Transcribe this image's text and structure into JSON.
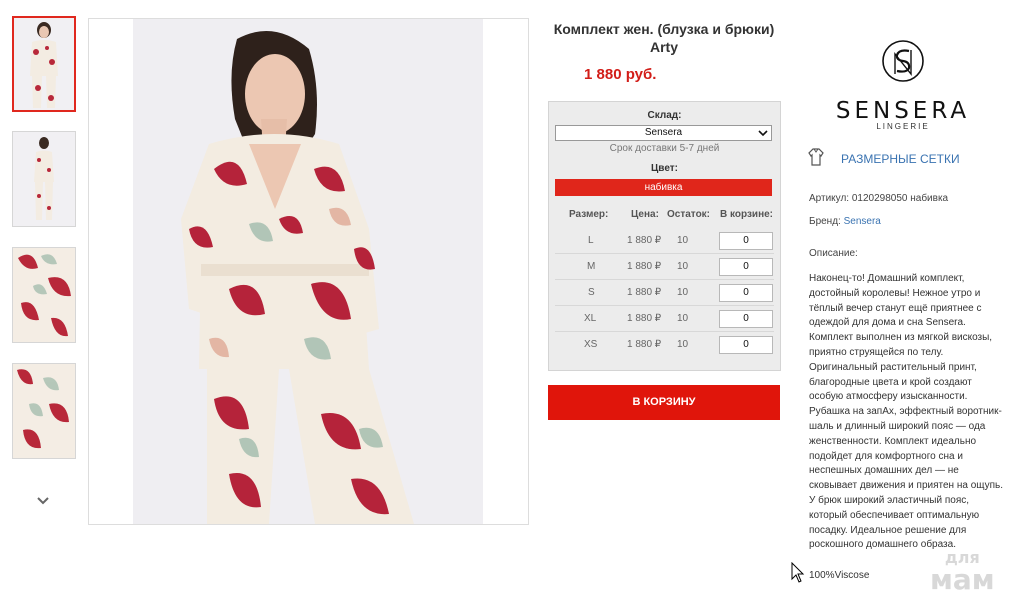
{
  "product": {
    "title": "Комплект жен. (блузка и брюки) Arty",
    "price": "1 880 руб."
  },
  "thumbnails": [
    {
      "label": "thumb-1",
      "active": true
    },
    {
      "label": "thumb-2",
      "active": false
    },
    {
      "label": "thumb-3",
      "active": false
    },
    {
      "label": "thumb-4",
      "active": false
    }
  ],
  "panel": {
    "warehouse_label": "Склад:",
    "warehouse_value": "Sensera",
    "delivery": "Срок доставки 5-7 дней",
    "color_label": "Цвет:",
    "color_value": "набивка",
    "headers": [
      "Размер:",
      "Цена:",
      "Остаток:",
      "В корзине:"
    ],
    "rows": [
      {
        "size": "L",
        "price": "1 880 ₽",
        "stock": "10",
        "qty": "0"
      },
      {
        "size": "M",
        "price": "1 880 ₽",
        "stock": "10",
        "qty": "0"
      },
      {
        "size": "S",
        "price": "1 880 ₽",
        "stock": "10",
        "qty": "0"
      },
      {
        "size": "XL",
        "price": "1 880 ₽",
        "stock": "10",
        "qty": "0"
      },
      {
        "size": "XS",
        "price": "1 880 ₽",
        "stock": "10",
        "qty": "0"
      }
    ]
  },
  "cart_button": "В КОРЗИНУ",
  "brand": {
    "name": "SENSERA",
    "sub": "LINGERIE",
    "size_charts": "РАЗМЕРНЫЕ СЕТКИ",
    "article_label": "Артикул:",
    "article_value": "0120298050 набивка",
    "brand_label": "Бренд:",
    "brand_value": "Sensera",
    "desc_label": "Описание:",
    "description": "Наконец-то! Домашний комплект, достойный королевы! Нежное утро и тёплый вечер станут ещё приятнее с одеждой для дома и сна Sensera. Комплект выполнен из мягкой вискозы, приятно струящейся по телу. Оригинальный растительный принт, благородные цвета и крой создают особую атмосферу изысканности. Рубашка на запАх, эффектный воротник-шаль и длинный широкий пояс — ода женственности. Комплект идеально подойдет для комфортного сна и неспешных домашних дел — не сковывает движения и приятен на ощупь. У брюк широкий эластичный пояс, который обеспечивает оптимальную посадку. Идеальное решение для роскошного домашнего образа.",
    "fabric": "100%Viscose"
  },
  "watermark": {
    "line1": "для",
    "line2": "мам"
  },
  "colors": {
    "accent": "#e0261b",
    "link": "#3a73b1",
    "price": "#d21d18"
  }
}
